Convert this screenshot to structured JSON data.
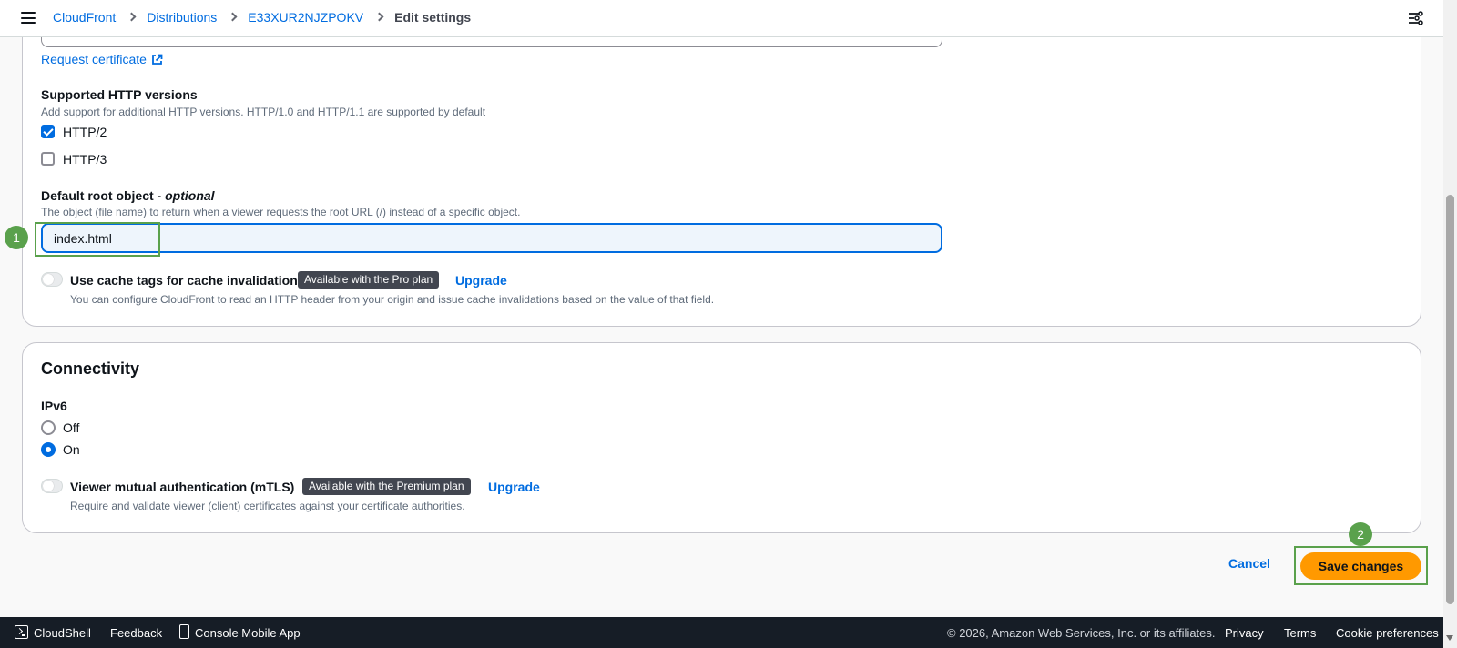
{
  "breadcrumb": {
    "items": [
      "CloudFront",
      "Distributions",
      "E33XUR2NJZPOKV"
    ],
    "current": "Edit settings"
  },
  "settings": {
    "request_certificate": "Request certificate",
    "http_versions": {
      "label": "Supported HTTP versions",
      "description": "Add support for additional HTTP versions. HTTP/1.0 and HTTP/1.1 are supported by default",
      "options": [
        {
          "label": "HTTP/2",
          "checked": true
        },
        {
          "label": "HTTP/3",
          "checked": false
        }
      ]
    },
    "default_root_object": {
      "label": "Default root object - ",
      "label_optional": "optional",
      "description": "The object (file name) to return when a viewer requests the root URL (/) instead of a specific object.",
      "value": "index.html"
    },
    "cache_tags": {
      "label": "Use cache tags for cache invalidation",
      "badge": "Available with the Pro plan",
      "upgrade": "Upgrade",
      "description": "You can configure CloudFront to read an HTTP header from your origin and issue cache invalidations based on the value of that field.",
      "enabled": false
    }
  },
  "connectivity": {
    "title": "Connectivity",
    "ipv6": {
      "label": "IPv6",
      "options": [
        {
          "label": "Off",
          "selected": false
        },
        {
          "label": "On",
          "selected": true
        }
      ]
    },
    "mtls": {
      "label": "Viewer mutual authentication (mTLS)",
      "badge": "Available with the Premium plan",
      "upgrade": "Upgrade",
      "description": "Require and validate viewer (client) certificates against your certificate authorities.",
      "enabled": false
    }
  },
  "actions": {
    "cancel": "Cancel",
    "save": "Save changes"
  },
  "markers": [
    "1",
    "2"
  ],
  "footer": {
    "cloudshell": "CloudShell",
    "feedback": "Feedback",
    "mobile_app": "Console Mobile App",
    "copyright": "© 2026, Amazon Web Services, Inc. or its affiliates.",
    "privacy": "Privacy",
    "terms": "Terms",
    "cookie": "Cookie preferences"
  },
  "colors": {
    "link": "#006ce0",
    "primary_button": "#ff9900",
    "marker": "#5aa14c",
    "footer_bg": "#161d26"
  }
}
